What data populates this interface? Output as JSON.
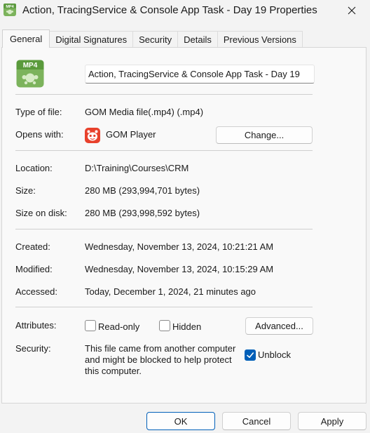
{
  "window": {
    "title": "Action, TracingService & Console App Task - Day 19 Properties",
    "icon": "mp4-file-icon",
    "close_icon": "close-icon"
  },
  "tabs": [
    {
      "label": "General",
      "active": true
    },
    {
      "label": "Digital Signatures",
      "active": false
    },
    {
      "label": "Security",
      "active": false
    },
    {
      "label": "Details",
      "active": false
    },
    {
      "label": "Previous Versions",
      "active": false
    }
  ],
  "file": {
    "icon_badge": "MP4",
    "name": "Action, TracingService & Console App Task - Day 19"
  },
  "type": {
    "label": "Type of file:",
    "value": "GOM Media file(.mp4) (.mp4)"
  },
  "opens_with": {
    "label": "Opens with:",
    "app": "GOM Player",
    "app_icon": "gom-player-icon",
    "change_button": "Change..."
  },
  "location": {
    "label": "Location:",
    "value": "D:\\Training\\Courses\\CRM"
  },
  "size": {
    "label": "Size:",
    "value": "280 MB (293,994,701 bytes)"
  },
  "size_on_disk": {
    "label": "Size on disk:",
    "value": "280 MB (293,998,592 bytes)"
  },
  "created": {
    "label": "Created:",
    "value": "Wednesday, November 13, 2024, 10:21:21 AM"
  },
  "modified": {
    "label": "Modified:",
    "value": "Wednesday, November 13, 2024, 10:15:29 AM"
  },
  "accessed": {
    "label": "Accessed:",
    "value": "Today, December 1, 2024, 21 minutes ago"
  },
  "attributes": {
    "label": "Attributes:",
    "readonly_label": "Read-only",
    "readonly_checked": false,
    "hidden_label": "Hidden",
    "hidden_checked": false,
    "advanced_button": "Advanced..."
  },
  "security": {
    "label": "Security:",
    "text": "This file came from another computer and might be blocked to help protect this computer.",
    "unblock_label": "Unblock",
    "unblock_checked": true
  },
  "footer": {
    "ok": "OK",
    "cancel": "Cancel",
    "apply": "Apply"
  },
  "colors": {
    "accent": "#005fb8",
    "mp4_icon_green": "#6aa84f",
    "gom_red": "#e8412c"
  }
}
